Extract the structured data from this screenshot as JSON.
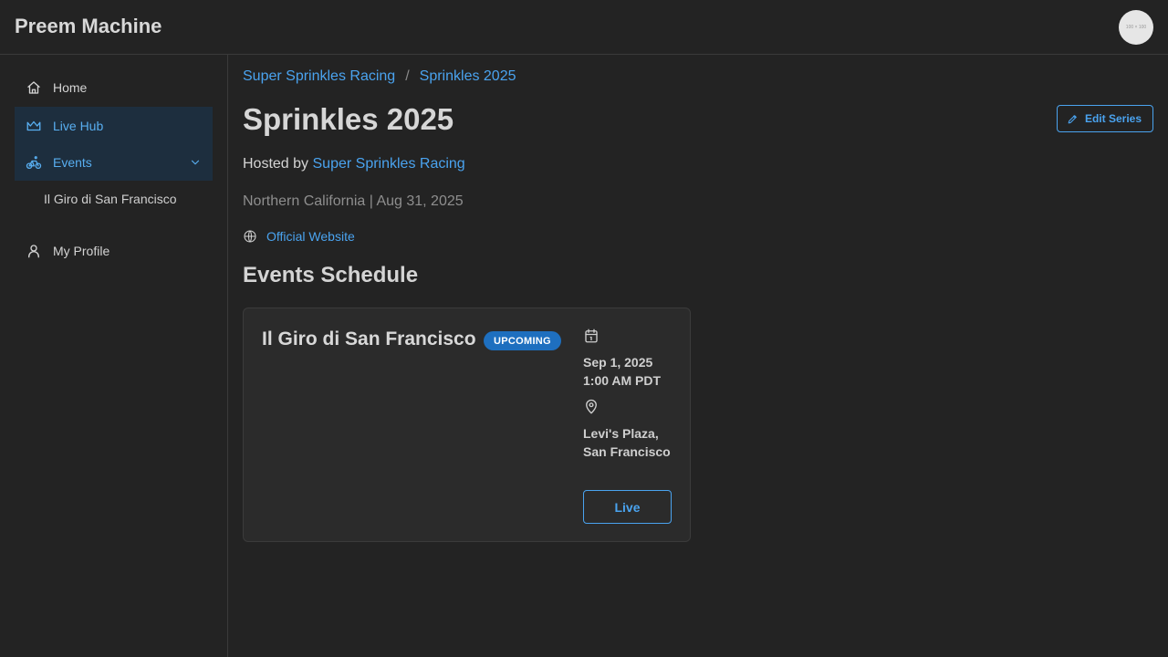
{
  "app": {
    "title": "Preem Machine",
    "avatar_text": "100 × 100"
  },
  "sidebar": {
    "items": [
      {
        "label": "Home",
        "icon": "home-icon"
      },
      {
        "label": "Live Hub",
        "icon": "crown-icon"
      },
      {
        "label": "Events",
        "icon": "bike-icon"
      },
      {
        "label": "My Profile",
        "icon": "user-icon"
      }
    ],
    "sub_items": [
      {
        "label": "Il Giro di San Francisco"
      }
    ]
  },
  "breadcrumb": {
    "items": [
      "Super Sprinkles Racing",
      "Sprinkles 2025"
    ],
    "separator": "/"
  },
  "page": {
    "title": "Sprinkles 2025",
    "edit_label": "Edit Series",
    "hosted_prefix": "Hosted by",
    "host": "Super Sprinkles Racing",
    "meta": "Northern California | Aug 31, 2025",
    "website_label": "Official Website",
    "section_title": "Events Schedule"
  },
  "events": [
    {
      "name": "Il Giro di San Francisco",
      "status": "UPCOMING",
      "date": "Sep 1, 2025",
      "time": "1:00 AM PDT",
      "location_line1": "Levi's Plaza,",
      "location_line2": "San Francisco",
      "button_label": "Live"
    }
  ],
  "colors": {
    "background": "#232323",
    "accent": "#4aa3ef",
    "active_bg": "#1d2e3e",
    "badge": "#1e6fbf",
    "card": "#2b2b2b"
  }
}
